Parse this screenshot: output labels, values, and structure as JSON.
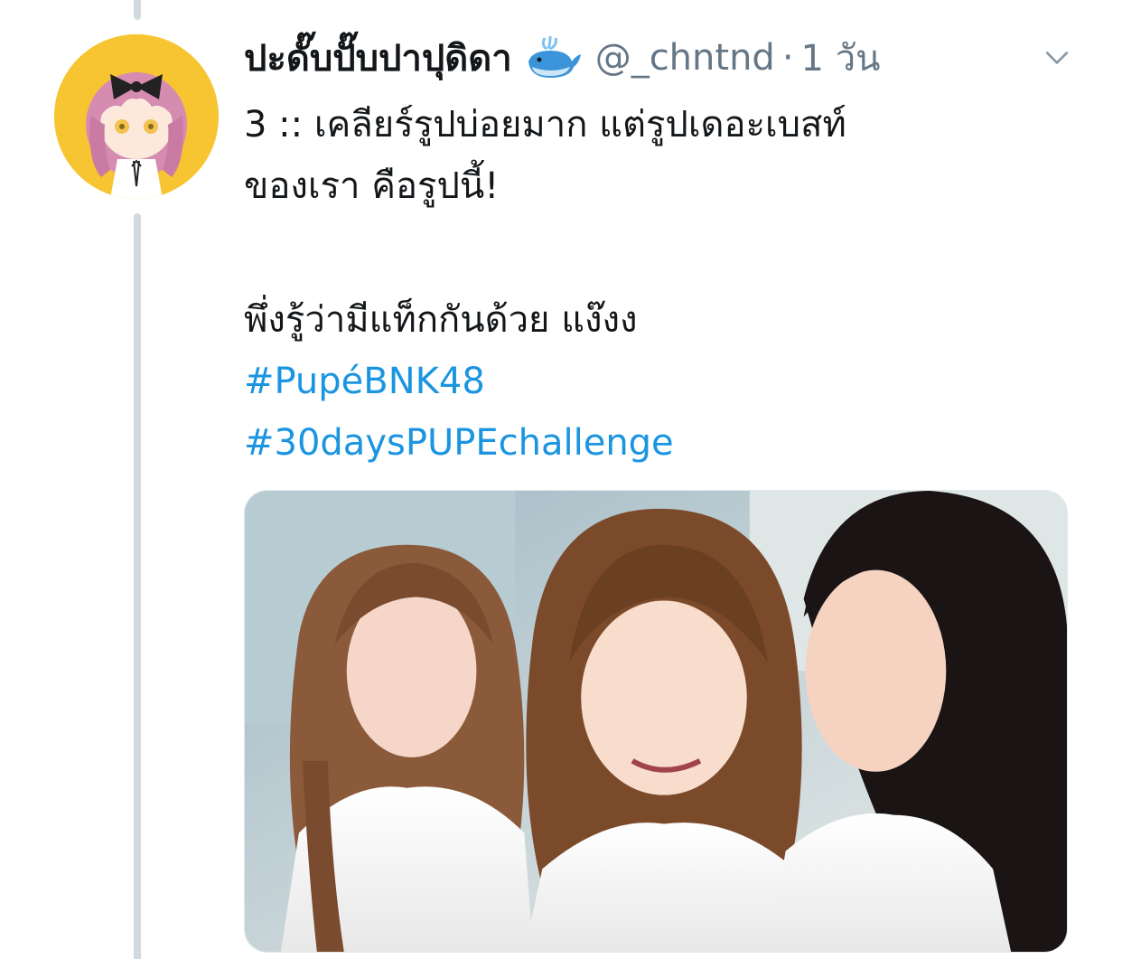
{
  "tweet": {
    "display_name": "ปะดั๊บปั๊บปาปุดิดา",
    "name_emoji_icon": "whale-icon",
    "handle": "@_chntnd",
    "separator": "·",
    "time": "1 วัน",
    "text_lines": [
      "3 :: เคลียร์รูปบ่อยมาก แต่รูปเดอะเบสท์",
      "ของเรา คือรูปนี้!",
      "พึ่งรู้ว่ามีแท็กกันด้วย แง๊งง"
    ],
    "hashtags": [
      "#PupéBNK48",
      "#30daysPUPEchallenge"
    ]
  },
  "icons": {
    "menu": "chevron-down-icon"
  },
  "colors": {
    "text": "#14171a",
    "secondary": "#657786",
    "link": "#1b95e0",
    "thread_line": "#cfd9de",
    "avatar_bg": "#f7c531"
  }
}
